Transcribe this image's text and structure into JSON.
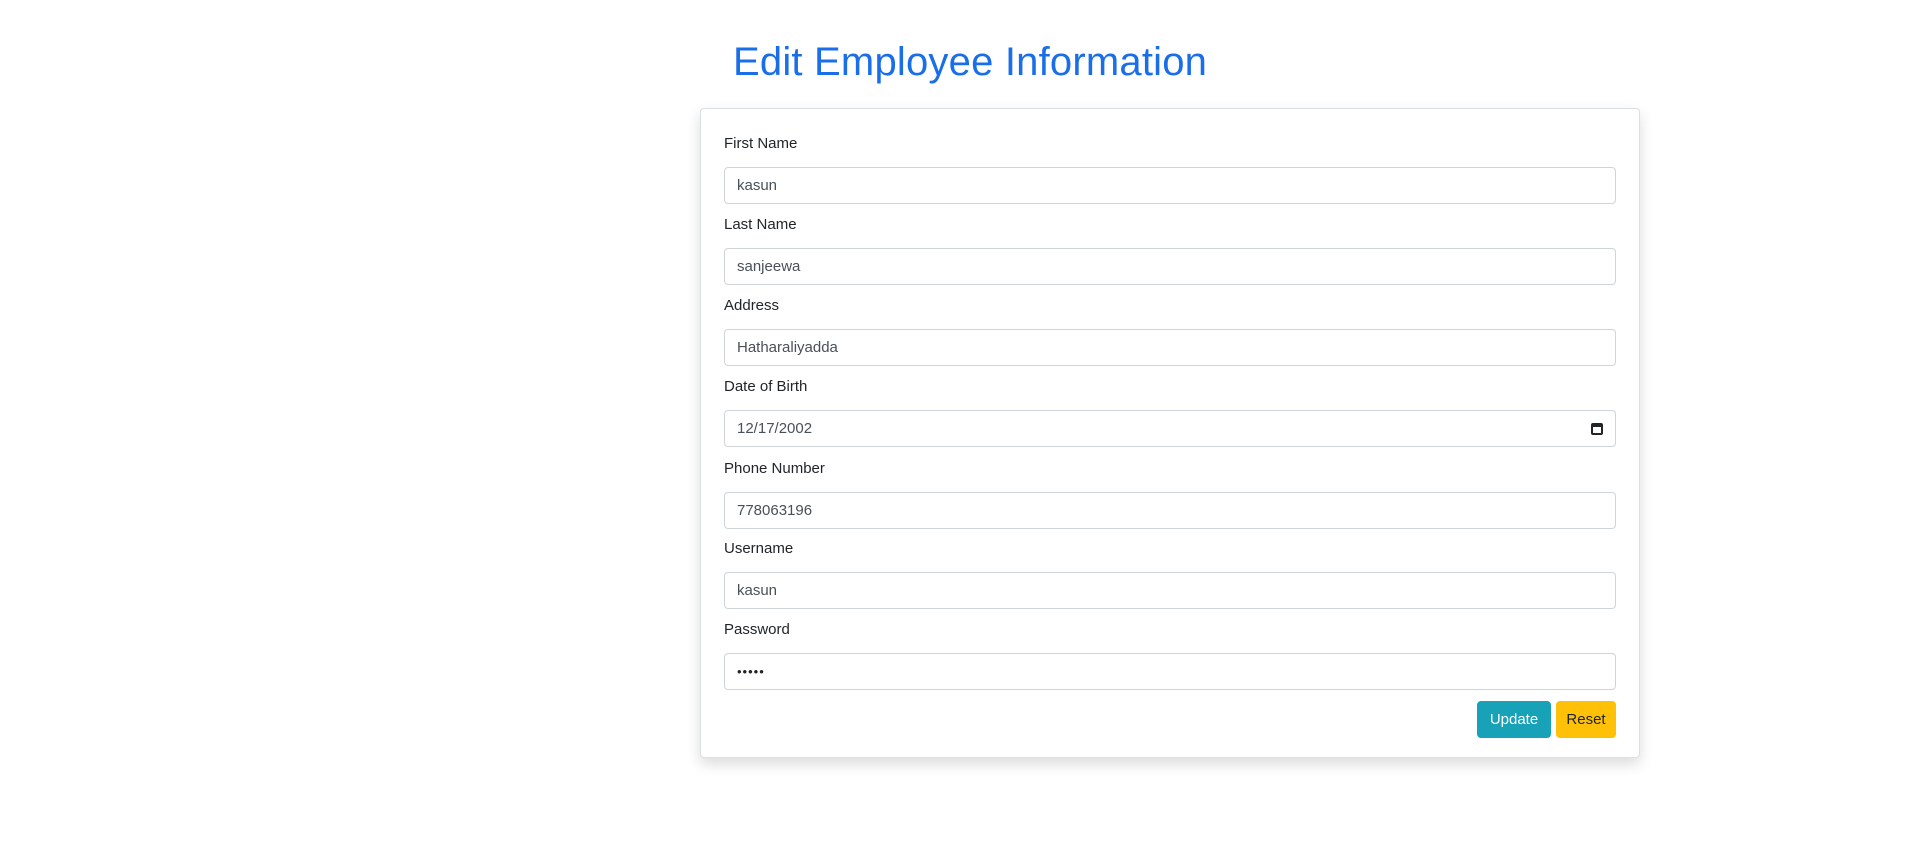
{
  "page": {
    "title": "Edit Employee Information"
  },
  "form": {
    "fields": [
      {
        "label": "First Name",
        "value": "kasun"
      },
      {
        "label": "Last Name",
        "value": "sanjeewa"
      },
      {
        "label": "Address",
        "value": "Hatharaliyadda"
      },
      {
        "label": "Date of Birth",
        "value": "12/17/2002"
      },
      {
        "label": "Phone Number",
        "value": "778063196"
      },
      {
        "label": "Username",
        "value": "kasun"
      },
      {
        "label": "Password",
        "value": "•••••"
      }
    ],
    "update_label": "Update",
    "reset_label": "Reset"
  },
  "colors": {
    "title": "#1a6fe8",
    "update_button": "#17a2b8",
    "reset_button": "#ffc107"
  },
  "icons": {
    "date_picker": "calendar-icon"
  }
}
